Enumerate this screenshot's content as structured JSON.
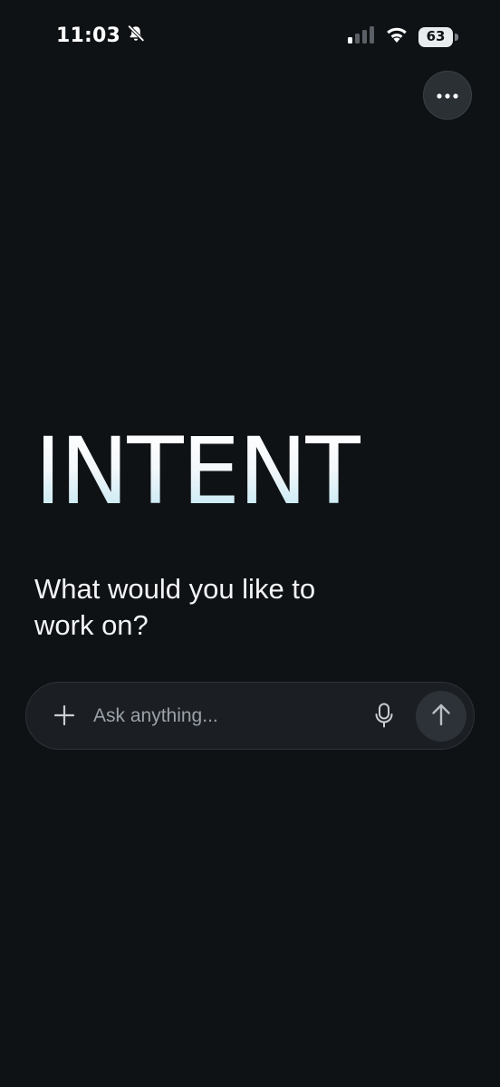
{
  "status_bar": {
    "time": "11:03",
    "battery_level": "63",
    "icons": [
      "bell-slash-icon",
      "cellular-signal-icon",
      "wifi-icon",
      "battery-icon"
    ]
  },
  "header": {
    "more_icon": "ellipsis-icon"
  },
  "main": {
    "brand": "INTENT",
    "prompt": "What would you like to work on?"
  },
  "composer": {
    "placeholder": "Ask anything...",
    "value": "",
    "add_icon": "plus-icon",
    "mic_icon": "microphone-icon",
    "send_icon": "arrow-up-icon"
  },
  "colors": {
    "background": "#0f1215",
    "surface": "#1b1f23",
    "button": "#2b3035",
    "text": "#f3f4f6",
    "muted": "#9aa1a8",
    "brand_gradient_end": "#bfe6f2"
  }
}
